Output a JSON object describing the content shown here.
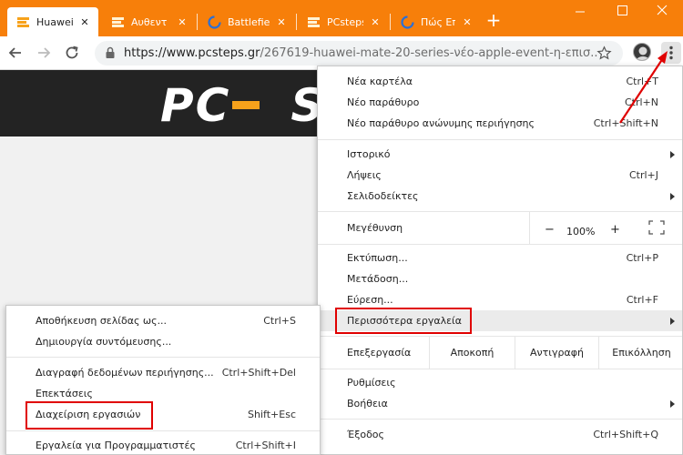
{
  "tabs": [
    {
      "title": "Huawei",
      "active": true
    },
    {
      "title": "Αυθεντ",
      "active": false
    },
    {
      "title": "Battlefie",
      "active": false
    },
    {
      "title": "PCsteps",
      "active": false
    },
    {
      "title": "Πώς Επ",
      "active": false
    }
  ],
  "address_bar": {
    "url_host": "https://www.pcsteps.gr",
    "url_rest": "/267619-huawei-mate-20-series-νέο-apple-event-η-επισ..."
  },
  "page": {
    "logo_left": "PC",
    "logo_right": "S"
  },
  "main_menu": {
    "new_tab": {
      "label": "Νέα καρτέλα",
      "shortcut": "Ctrl+T"
    },
    "new_window": {
      "label": "Νέο παράθυρο",
      "shortcut": "Ctrl+N"
    },
    "new_incognito": {
      "label": "Νέο παράθυρο ανώνυμης περιήγησης",
      "shortcut": "Ctrl+Shift+N"
    },
    "history": {
      "label": "Ιστορικό"
    },
    "downloads": {
      "label": "Λήψεις",
      "shortcut": "Ctrl+J"
    },
    "bookmarks": {
      "label": "Σελιδοδείκτες"
    },
    "zoom": {
      "label": "Μεγέθυνση",
      "minus": "−",
      "value": "100%",
      "plus": "+"
    },
    "print": {
      "label": "Εκτύπωση...",
      "shortcut": "Ctrl+P"
    },
    "cast": {
      "label": "Μετάδοση..."
    },
    "find": {
      "label": "Εύρεση...",
      "shortcut": "Ctrl+F"
    },
    "more_tools": {
      "label": "Περισσότερα εργαλεία"
    },
    "edit": {
      "label": "Επεξεργασία",
      "cut": "Αποκοπή",
      "copy": "Αντιγραφή",
      "paste": "Επικόλληση"
    },
    "settings": {
      "label": "Ρυθμίσεις"
    },
    "help": {
      "label": "Βοήθεια"
    },
    "exit": {
      "label": "Έξοδος",
      "shortcut": "Ctrl+Shift+Q"
    }
  },
  "submenu": {
    "save_page": {
      "label": "Αποθήκευση σελίδας ως...",
      "shortcut": "Ctrl+S"
    },
    "create_shortcut": {
      "label": "Δημιουργία συντόμευσης..."
    },
    "clear_data": {
      "label": "Διαγραφή δεδομένων περιήγησης...",
      "shortcut": "Ctrl+Shift+Del"
    },
    "extensions": {
      "label": "Επεκτάσεις"
    },
    "task_manager": {
      "label": "Διαχείριση εργασιών",
      "shortcut": "Shift+Esc"
    },
    "dev_tools": {
      "label": "Εργαλεία για Προγραμματιστές",
      "shortcut": "Ctrl+Shift+I"
    }
  },
  "colors": {
    "accent_orange": "#f77f0a",
    "highlight_red": "#e00000"
  }
}
